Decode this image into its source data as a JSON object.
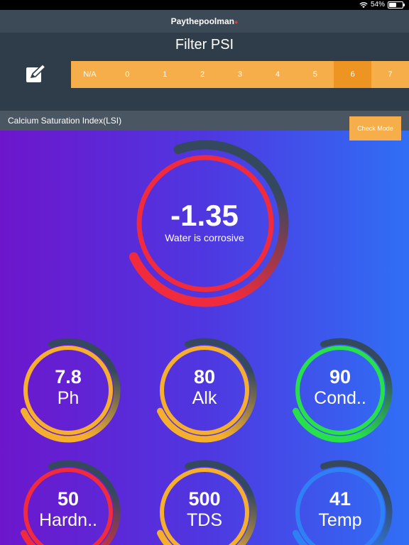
{
  "status_bar": {
    "battery": "54%",
    "battery_level": 0.54
  },
  "app": {
    "brand": "Paythepoolman",
    "brand_mark": "●"
  },
  "psi": {
    "title": "Filter PSI",
    "options": [
      "N/A",
      "0",
      "1",
      "2",
      "3",
      "4",
      "5",
      "6",
      "7"
    ],
    "selected": "6"
  },
  "lsi": {
    "title": "Calcium Saturation Index(LSI)",
    "check_mode_label": "Check Mode"
  },
  "main_gauge": {
    "value": "-1.35",
    "status": "Water is corrosive",
    "color": "#ef2b3d"
  },
  "gauges": [
    {
      "value": "7.8",
      "label": "Ph",
      "color": "#f6ae2d"
    },
    {
      "value": "80",
      "label": "Alk",
      "color": "#f6ae2d"
    },
    {
      "value": "90",
      "label": "Cond..",
      "color": "#27e04b"
    },
    {
      "value": "50",
      "label": "Hardn..",
      "color": "#ef2b3d"
    },
    {
      "value": "500",
      "label": "TDS",
      "color": "#f6ae2d"
    },
    {
      "value": "41",
      "label": "Temp",
      "color": "#2f7ff5"
    }
  ],
  "colors": {
    "header": "#3c4a57",
    "panel": "#2f3d4a",
    "accent": "#f6ae4b",
    "accent_selected": "#ee9422"
  }
}
